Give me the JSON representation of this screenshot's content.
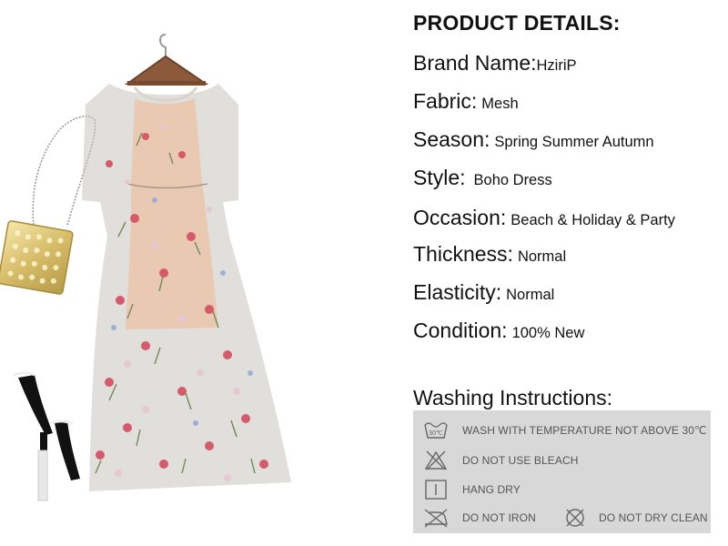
{
  "product_details": {
    "heading": "PRODUCT DETAILS:",
    "brand": {
      "key": "Brand Name:",
      "value": "HziriP"
    },
    "fabric": {
      "key": "Fabric:",
      "value": "Mesh"
    },
    "season": {
      "key": "Season:",
      "value": "Spring Summer Autumn"
    },
    "style": {
      "key": "Style:",
      "value": "Boho Dress"
    },
    "occasion": {
      "key": "Occasion:",
      "value": "Beach & Holiday & Party"
    },
    "thickness": {
      "key": "Thickness:",
      "value": "Normal"
    },
    "elasticity": {
      "key": "Elasticity:",
      "value": "Normal"
    },
    "condition": {
      "key": "Condition:",
      "value": "100% New"
    }
  },
  "washing": {
    "title": "Washing Instructions:",
    "items": [
      {
        "icon": "wash-30-icon",
        "label": "WASH WITH TEMPERATURE NOT ABOVE 30℃"
      },
      {
        "icon": "no-bleach-icon",
        "label": "DO NOT USE BLEACH"
      },
      {
        "icon": "hang-dry-icon",
        "label": "HANG DRY"
      },
      {
        "icon": "no-iron-icon",
        "label": "DO NOT IRON"
      },
      {
        "icon": "no-dry-clean-icon",
        "label": "DO NOT DRY CLEAN"
      }
    ],
    "wash_temp_mark": "30℃"
  },
  "colors": {
    "panel_background": "#d8d8d8",
    "panel_text": "#555555",
    "heading_text": "#111111"
  }
}
